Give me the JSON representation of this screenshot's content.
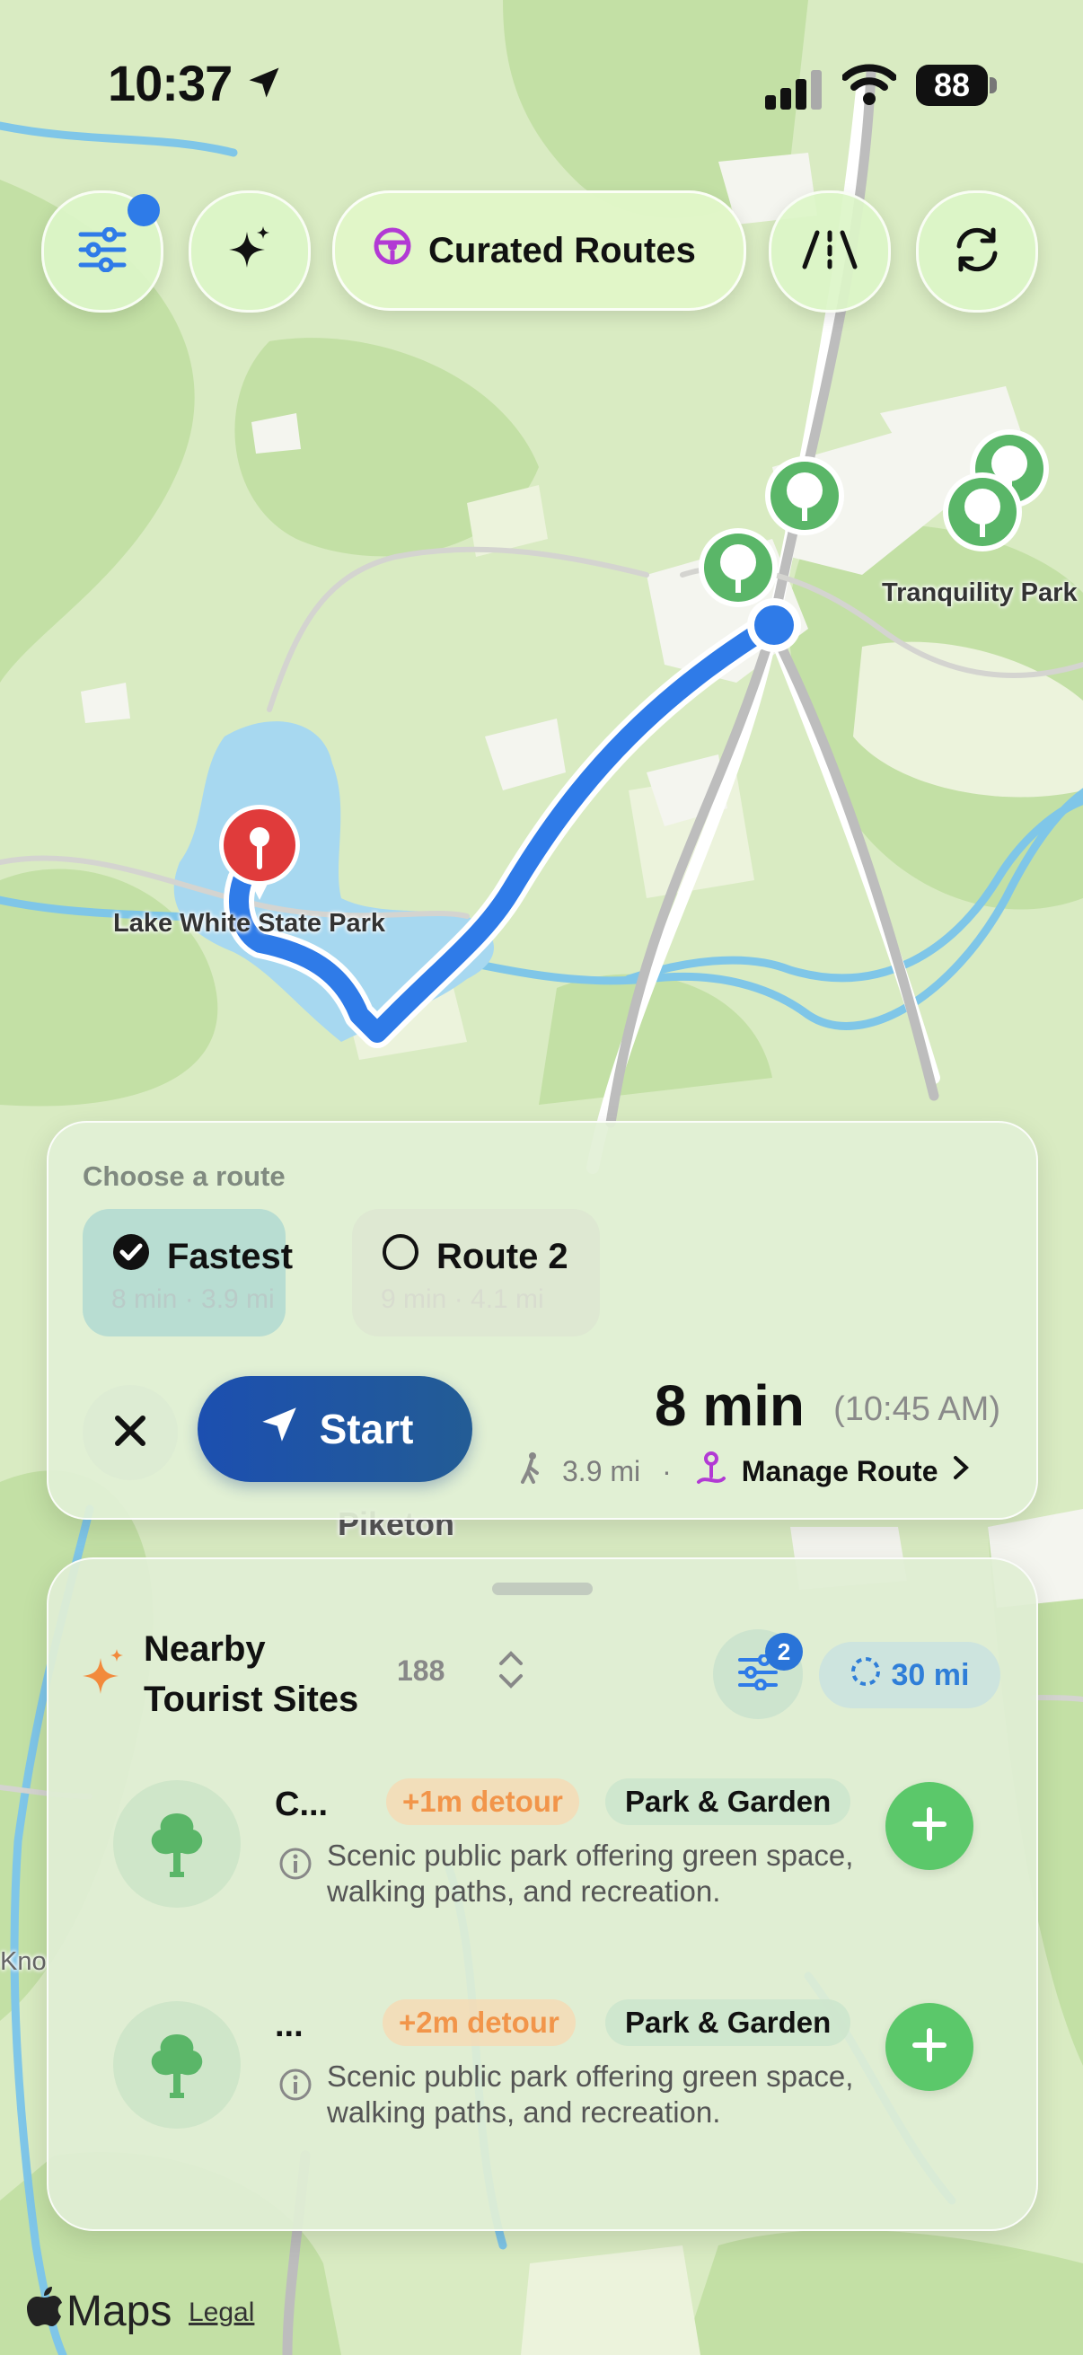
{
  "status_bar": {
    "time": "10:37",
    "battery": "88"
  },
  "toolbar": {
    "filters_icon": "sliders-icon",
    "magic_icon": "sparkle-icon",
    "curated_label": "Curated Routes",
    "road_icon": "road-icon",
    "refresh_icon": "refresh-icon"
  },
  "map": {
    "labels": {
      "lake": "Lake White State Park",
      "tranquility": "Tranquility Park",
      "town": "Piketon",
      "edge": "Kno"
    }
  },
  "route_card": {
    "choose_label": "Choose a route",
    "options": [
      {
        "label": "Fastest",
        "sub": "8 min · 3.9 mi",
        "selected": true
      },
      {
        "label": "Route 2",
        "sub": "9 min · 4.1 mi",
        "selected": false
      }
    ],
    "start_label": "Start",
    "eta_time": "8 min",
    "eta_clock": "(10:45 AM)",
    "distance": "3.9 mi",
    "separator": "·",
    "manage_label": "Manage Route"
  },
  "nearby": {
    "title_line1": "Nearby",
    "title_line2": "Tourist Sites",
    "count": "188",
    "filter_badge": "2",
    "radius": "30 mi",
    "sites": [
      {
        "name": "C...",
        "detour": "+1m detour",
        "category": "Park & Garden",
        "description": "Scenic public park offering green space, walking paths, and recreation."
      },
      {
        "name": "...",
        "detour": "+2m detour",
        "category": "Park & Garden",
        "description": "Scenic public park offering green space, walking paths, and recreation."
      }
    ]
  },
  "footer": {
    "brand": "Maps",
    "legal": "Legal"
  },
  "colors": {
    "accent_blue": "#2e7be8",
    "start_blue": "#1c4fb0",
    "add_green": "#5bc86a",
    "detour_orange": "#f2954a",
    "pin_red": "#e03b3b"
  }
}
